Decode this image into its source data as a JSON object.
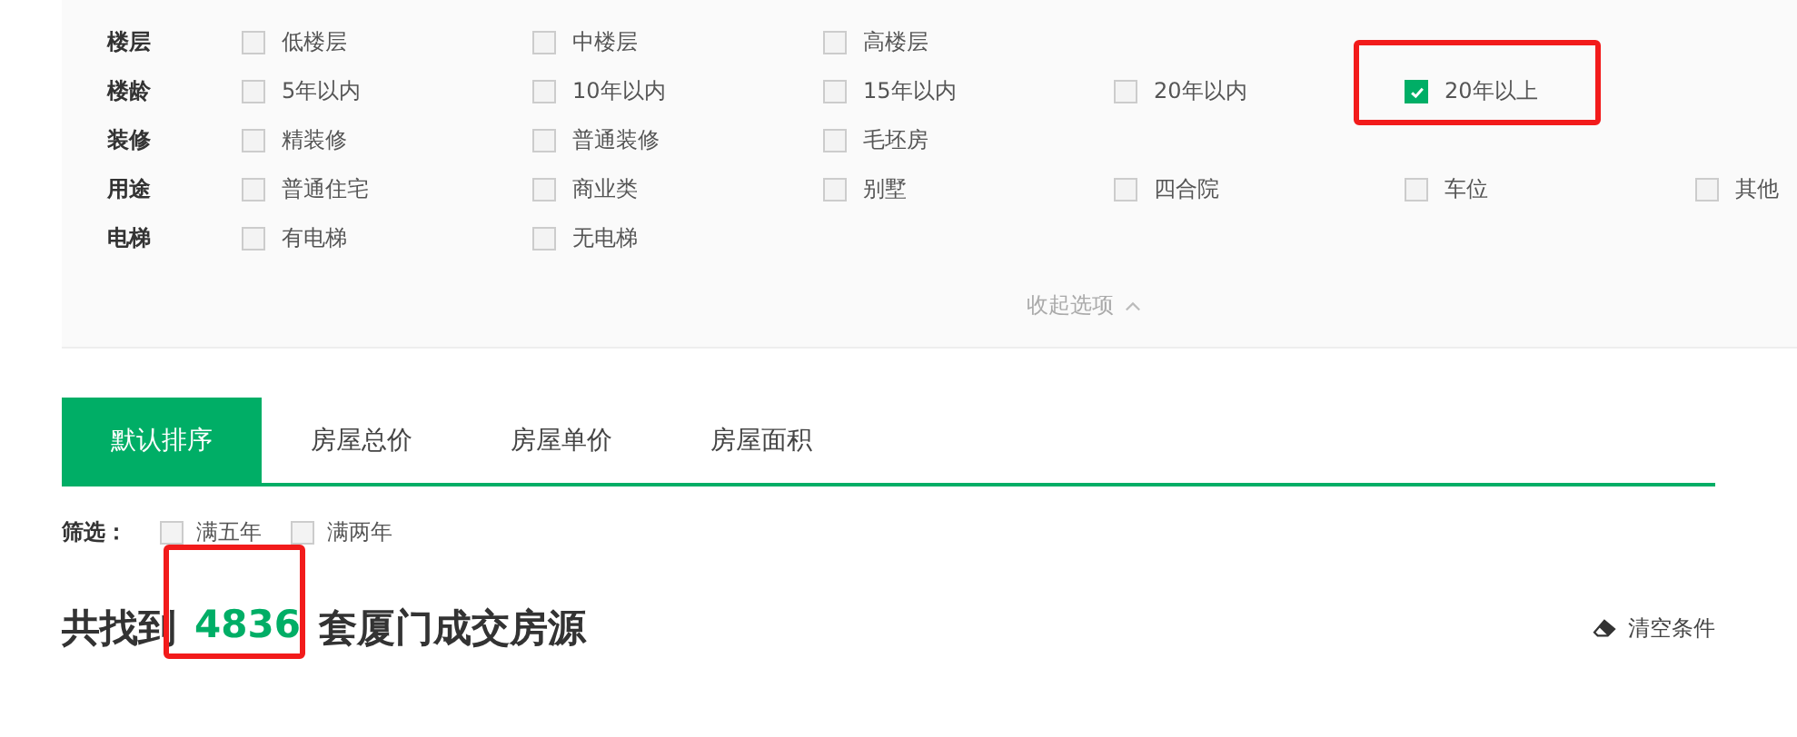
{
  "filters": [
    {
      "label": "楼层",
      "options": [
        {
          "text": "低楼层",
          "checked": false,
          "highlighted": false
        },
        {
          "text": "中楼层",
          "checked": false,
          "highlighted": false
        },
        {
          "text": "高楼层",
          "checked": false,
          "highlighted": false
        }
      ]
    },
    {
      "label": "楼龄",
      "options": [
        {
          "text": "5年以内",
          "checked": false,
          "highlighted": false
        },
        {
          "text": "10年以内",
          "checked": false,
          "highlighted": false
        },
        {
          "text": "15年以内",
          "checked": false,
          "highlighted": false
        },
        {
          "text": "20年以内",
          "checked": false,
          "highlighted": false
        },
        {
          "text": "20年以上",
          "checked": true,
          "highlighted": true
        }
      ]
    },
    {
      "label": "装修",
      "options": [
        {
          "text": "精装修",
          "checked": false,
          "highlighted": false
        },
        {
          "text": "普通装修",
          "checked": false,
          "highlighted": false
        },
        {
          "text": "毛坯房",
          "checked": false,
          "highlighted": false
        }
      ]
    },
    {
      "label": "用途",
      "options": [
        {
          "text": "普通住宅",
          "checked": false,
          "highlighted": false
        },
        {
          "text": "商业类",
          "checked": false,
          "highlighted": false
        },
        {
          "text": "别墅",
          "checked": false,
          "highlighted": false
        },
        {
          "text": "四合院",
          "checked": false,
          "highlighted": false
        },
        {
          "text": "车位",
          "checked": false,
          "highlighted": false
        },
        {
          "text": "其他",
          "checked": false,
          "highlighted": false
        }
      ]
    },
    {
      "label": "电梯",
      "options": [
        {
          "text": "有电梯",
          "checked": false,
          "highlighted": false
        },
        {
          "text": "无电梯",
          "checked": false,
          "highlighted": false
        }
      ]
    }
  ],
  "collapse_link": "收起选项",
  "sort_tabs": [
    {
      "label": "默认排序",
      "selected": true
    },
    {
      "label": "房屋总价",
      "selected": false
    },
    {
      "label": "房屋单价",
      "selected": false
    },
    {
      "label": "房屋面积",
      "selected": false
    }
  ],
  "quick_filter": {
    "label": "筛选：",
    "options": [
      {
        "text": "满五年",
        "checked": false
      },
      {
        "text": "满两年",
        "checked": false
      }
    ]
  },
  "result": {
    "prefix": "共找到",
    "count": "4836",
    "suffix": "套厦门成交房源",
    "count_highlighted": true
  },
  "clear_button": "清空条件"
}
